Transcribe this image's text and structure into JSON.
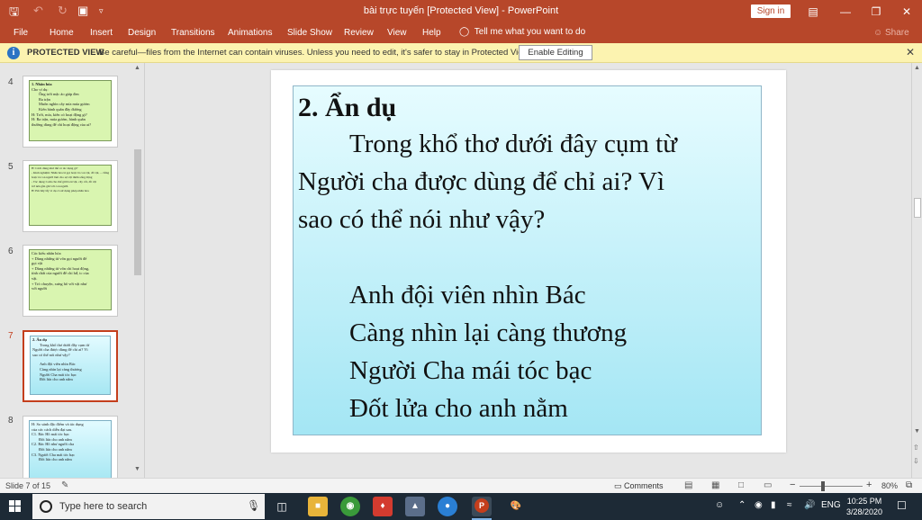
{
  "window": {
    "title": "bài trực tuyến [Protected View]  -  PowerPoint",
    "sign_in": "Sign in",
    "accent": "#b7472a"
  },
  "ribbon": {
    "tabs": [
      "File",
      "Home",
      "Insert",
      "Design",
      "Transitions",
      "Animations",
      "Slide Show",
      "Review",
      "View",
      "Help"
    ],
    "tell_me": "Tell me what you want to do",
    "share": "Share"
  },
  "protected_view": {
    "label": "PROTECTED VIEW",
    "message": "Be careful—files from the Internet can contain viruses. Unless you need to edit, it's safer to stay in Protected View.",
    "enable_button": "Enable Editing"
  },
  "thumbnails": [
    {
      "number": "4",
      "lines": [
        "1. Nhân hóa",
        "Cho ví dụ:",
        "Ông trời mặc áo giáp đen",
        "Ra trận",
        "Muôn nghìn cây mía múa gươm",
        "Kiến hành quân đầy đường",
        "H: Trời, mía, kiến có hoạt động gì?",
        "H: Ra trận, múa gươm, hành quân",
        "thường dùng để chỉ hoạt động của ai?"
      ]
    },
    {
      "number": "5",
      "lines": [
        "H: Cách dùng như thế có tác dụng gì?",
        "- Kinh nghiệm: Nhân hóa là gọi hoặc tả con vật, đồ vật, ... bằng những từ vốn được dùng để gọi",
        "hoặc tả con người làm cho sự vật thêm sống động",
        "- Tác dụng: Làm cho thế giới loài vật, cây cối, đồ vật",
        "trở nên gần gũi với con người.",
        "H: Em hãy lấy ví dụ có sử dụng phép nhân hóa"
      ]
    },
    {
      "number": "6",
      "lines": [
        "Các kiểu nhân hóa",
        "+ Dùng những từ vốn gọi người để",
        "gọi vật",
        "+ Dùng những từ vốn chỉ hoạt động,",
        "tính chất của người để chỉ hđ, tc của",
        "vật.",
        "+ Trò chuyện, xưng hô với vật như",
        "với người"
      ]
    },
    {
      "number": "7",
      "lines": [
        "2. Ẩn dụ",
        "Trong khổ thơ dưới đây cụm từ",
        "Người cha được dùng để chỉ ai? Vì",
        "sao có thể nói như vậy?",
        "",
        "Anh đội viên nhìn Bác",
        "Càng nhìn lại càng thương",
        "Người Cha mái tóc bạc",
        "Đốt lửa cho anh nằm"
      ]
    },
    {
      "number": "8",
      "lines": [
        "H: So sánh đặc điểm và tác dụng",
        "của các cách diễn đạt sau.",
        "C1. Bác Hồ mái tóc bạc",
        "Đốt lửa cho anh nằm",
        "C2. Bác Hồ như người cha",
        "Đốt lửa cho anh nằm",
        "C3. Người Cha mái tóc bạc",
        "Đốt lửa cho anh nằm"
      ]
    }
  ],
  "slide": {
    "title": "2. Ẩn dụ",
    "question_lines": [
      "Trong khổ thơ dưới đây cụm từ",
      "Người cha được dùng để chỉ ai? Vì",
      "sao có thể nói như vậy?"
    ],
    "poem_lines": [
      "Anh đội viên nhìn Bác",
      "Càng nhìn lại càng thương",
      "Người Cha mái tóc bạc",
      "Đốt lửa cho anh nằm"
    ]
  },
  "status": {
    "slide_indicator": "Slide 7 of 15",
    "comments": "Comments",
    "zoom": "80%",
    "zoom_level_percent": 80
  },
  "taskbar": {
    "search_placeholder": "Type here to search",
    "language": "ENG",
    "time": "10:25 PM",
    "date": "3/28/2020"
  }
}
